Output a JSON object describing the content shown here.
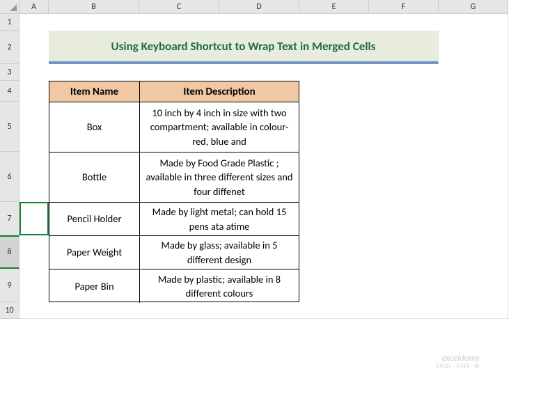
{
  "columns": [
    "A",
    "B",
    "C",
    "D",
    "E",
    "F",
    "G"
  ],
  "rows": [
    "1",
    "2",
    "3",
    "4",
    "5",
    "6",
    "7",
    "8",
    "9",
    "10"
  ],
  "selected_row_index": 7,
  "title": "Using Keyboard Shortcut to Wrap Text in Merged Cells",
  "table": {
    "headers": [
      "Item Name",
      "Item Description"
    ],
    "rows": [
      {
        "name": "Box",
        "desc": "10 inch by 4 inch in size with two compartment; available in colour-red, blue and"
      },
      {
        "name": "Bottle",
        "desc": "Made by Food Grade Plastic ; available in three different sizes and four diffenet"
      },
      {
        "name": "Pencil Holder",
        "desc": "Made by light metal; can hold 15 pens ata atime"
      },
      {
        "name": "Paper Weight",
        "desc": "Made by glass; available in 5 different design"
      },
      {
        "name": "Paper Bin",
        "desc": "Made by plastic; available in 8 different colours"
      }
    ]
  },
  "watermark": {
    "main": "exceldemy",
    "sub": "EXCEL · DATA · BI"
  },
  "chart_data": {
    "type": "table",
    "title": "Using Keyboard Shortcut to Wrap Text in Merged Cells",
    "columns": [
      "Item Name",
      "Item Description"
    ],
    "rows": [
      [
        "Box",
        "10 inch by 4 inch in size with two compartment; available in colour-red, blue and"
      ],
      [
        "Bottle",
        "Made by Food Grade Plastic ; available in three different sizes and four diffenet"
      ],
      [
        "Pencil Holder",
        "Made by light metal; can hold 15 pens ata atime"
      ],
      [
        "Paper Weight",
        "Made by glass; available in 5 different design"
      ],
      [
        "Paper Bin",
        "Made by plastic; available in 8 different colours"
      ]
    ]
  }
}
